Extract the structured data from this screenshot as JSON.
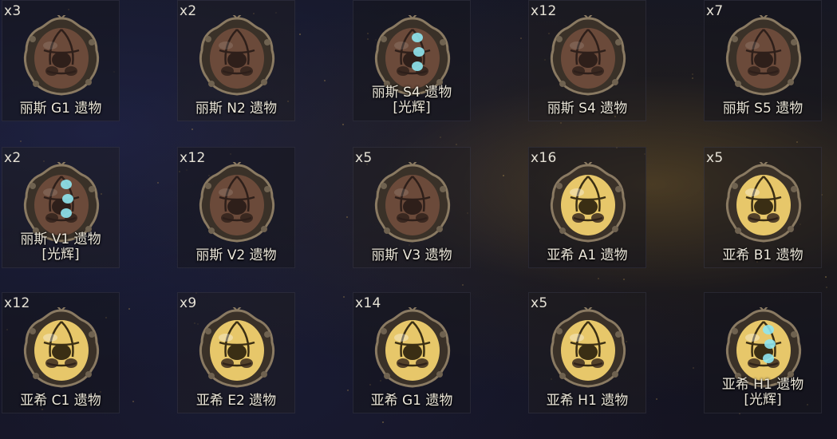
{
  "inventory": {
    "items": [
      {
        "count": "x3",
        "name": "丽斯 G1 遗物",
        "style": "bronze",
        "glow": false
      },
      {
        "count": "x2",
        "name": "丽斯 N2 遗物",
        "style": "bronze",
        "glow": false
      },
      {
        "count": "",
        "name": "丽斯 S4 遗物 [光辉]",
        "style": "bronze",
        "glow": true
      },
      {
        "count": "x12",
        "name": "丽斯 S4 遗物",
        "style": "bronze",
        "glow": false
      },
      {
        "count": "x7",
        "name": "丽斯 S5 遗物",
        "style": "bronze",
        "glow": false
      },
      {
        "count": "x2",
        "name": "丽斯 V1 遗物 [光辉]",
        "style": "bronze",
        "glow": true
      },
      {
        "count": "x12",
        "name": "丽斯 V2 遗物",
        "style": "bronze",
        "glow": false
      },
      {
        "count": "x5",
        "name": "丽斯 V3 遗物",
        "style": "bronze",
        "glow": false
      },
      {
        "count": "x16",
        "name": "亚希 A1 遗物",
        "style": "gold",
        "glow": false
      },
      {
        "count": "x5",
        "name": "亚希 B1 遗物",
        "style": "gold",
        "glow": false
      },
      {
        "count": "x12",
        "name": "亚希 C1 遗物",
        "style": "gold",
        "glow": false
      },
      {
        "count": "x9",
        "name": "亚希 E2 遗物",
        "style": "gold",
        "glow": false
      },
      {
        "count": "x14",
        "name": "亚希 G1 遗物",
        "style": "gold",
        "glow": false
      },
      {
        "count": "x5",
        "name": "亚希 H1 遗物",
        "style": "gold",
        "glow": false
      },
      {
        "count": "",
        "name": "亚希 H1 遗物 [光辉]",
        "style": "gold",
        "glow": true
      }
    ]
  },
  "colors": {
    "bronze_shell": "#6b4a3a",
    "bronze_dark": "#2e1f1a",
    "gold_shell": "#e7c76a",
    "gold_dark": "#3a2e14",
    "radiant_glow": "#8fe6ef",
    "frame": "#8a7a62"
  },
  "icons": {
    "relic": "relic-icon",
    "radiant_orb": "radiant-orb-icon"
  }
}
